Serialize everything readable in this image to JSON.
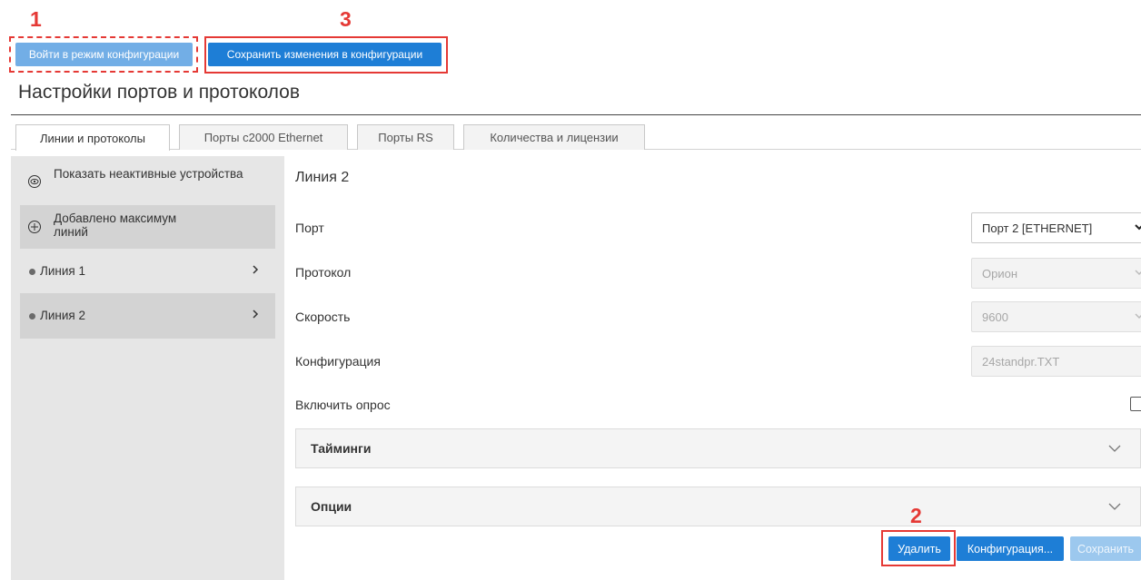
{
  "annotations": {
    "step1": "1",
    "step2": "2",
    "step3": "3"
  },
  "toolbar": {
    "enter_config": "Войти в режим конфигурации",
    "save_config": "Сохранить изменения в конфигурации"
  },
  "page": {
    "title": "Настройки портов и протоколов"
  },
  "tabs": [
    {
      "label": "Линии и протоколы",
      "active": true
    },
    {
      "label": "Порты с2000 Ethernet",
      "active": false
    },
    {
      "label": "Порты RS",
      "active": false
    },
    {
      "label": "Количества и лицензии",
      "active": false
    }
  ],
  "sidebar": {
    "show_inactive": {
      "label": "Показать неактивные устройства",
      "icon": "eye-icon"
    },
    "add_line": {
      "label": "Добавлено максимум линий",
      "icon": "plus-circle-icon"
    },
    "lines": [
      {
        "label": "Линия 1",
        "selected": false
      },
      {
        "label": "Линия 2",
        "selected": true
      }
    ]
  },
  "detail": {
    "title": "Линия 2",
    "port": {
      "label": "Порт",
      "value": "Порт 2 [ETHERNET]"
    },
    "protocol": {
      "label": "Протокол",
      "value": "Орион"
    },
    "speed": {
      "label": "Скорость",
      "value": "9600"
    },
    "configuration": {
      "label": "Конфигурация",
      "value": "24standpr.TXT"
    },
    "polling": {
      "label": "Включить опрос",
      "checked": false
    },
    "timings": "Тайминги",
    "options": "Опции"
  },
  "actions": {
    "delete": "Удалить",
    "configuration": "Конфигурация...",
    "save": "Сохранить"
  },
  "colors": {
    "accent": "#1e7ed6",
    "annotation": "#e53935",
    "sidebar": "#e6e6e6"
  }
}
